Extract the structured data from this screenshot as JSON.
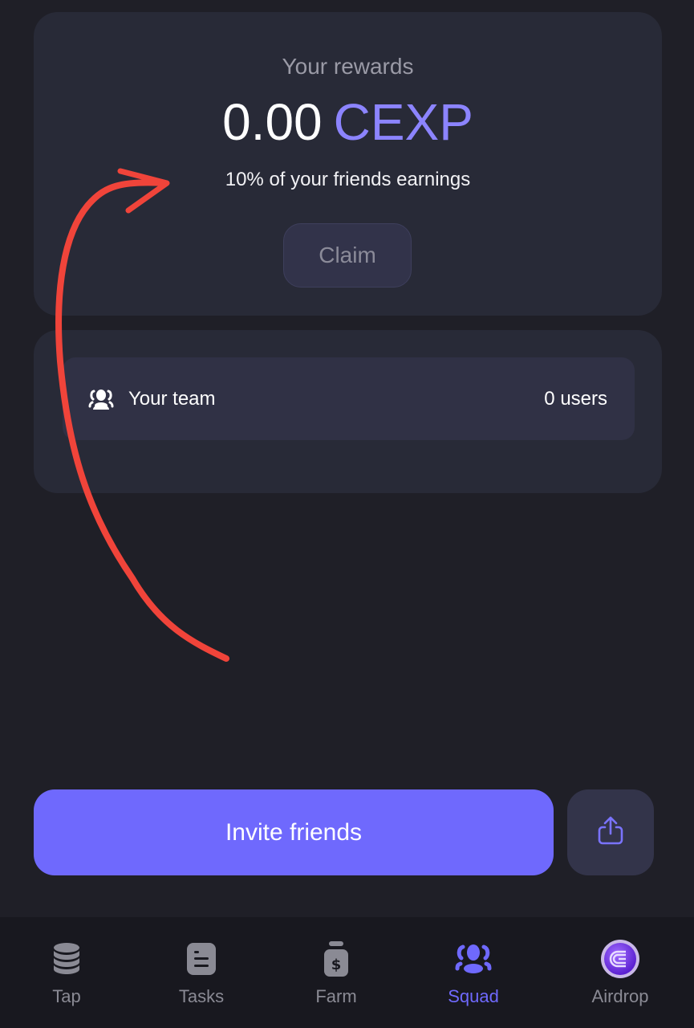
{
  "rewards": {
    "title": "Your rewards",
    "amount": "0.00",
    "unit": "CEXP",
    "subtitle": "10% of your friends earnings",
    "claim_label": "Claim"
  },
  "team": {
    "icon": "users-icon",
    "label": "Your team",
    "count": "0 users"
  },
  "actions": {
    "invite_label": "Invite friends",
    "share_icon": "share-icon"
  },
  "nav": {
    "active": "Squad",
    "items": [
      {
        "label": "Tap",
        "icon": "coins-stack-icon"
      },
      {
        "label": "Tasks",
        "icon": "task-list-icon"
      },
      {
        "label": "Farm",
        "icon": "money-bag-icon"
      },
      {
        "label": "Squad",
        "icon": "squad-icon"
      },
      {
        "label": "Airdrop",
        "icon": "cex-coin-icon"
      }
    ]
  },
  "colors": {
    "accent": "#6f69fd",
    "unit_text": "#8c84ff",
    "annotation_arrow": "#f0443a"
  }
}
